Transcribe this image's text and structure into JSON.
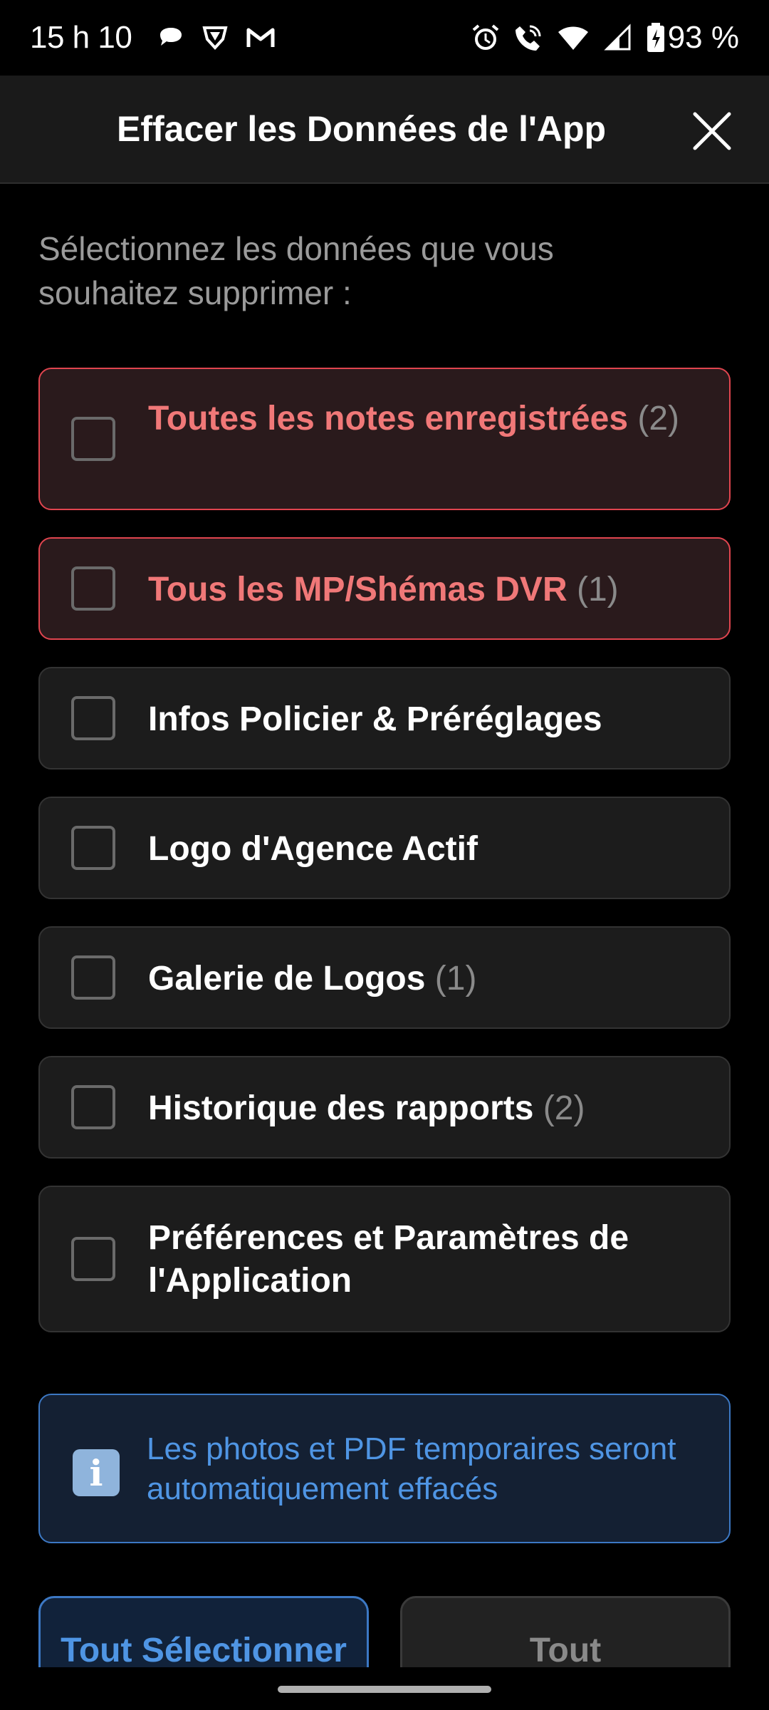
{
  "status_bar": {
    "time": "15 h 10",
    "battery": "93 %",
    "left_icons": [
      "chat-bubble-icon",
      "vpn-shield-icon",
      "gmail-icon"
    ],
    "right_icons": [
      "alarm-icon",
      "wifi-call-icon",
      "wifi-icon",
      "signal-icon",
      "battery-charging-icon"
    ]
  },
  "header": {
    "title": "Effacer les Données de l'App",
    "close_icon": "close-icon"
  },
  "prompt": "Sélectionnez les données que vous souhaitez supprimer :",
  "options": [
    {
      "label": "Toutes les notes enregistrées",
      "count": "(2)",
      "danger": true,
      "checked": false
    },
    {
      "label": "Tous les MP/Shémas DVR",
      "count": "(1)",
      "danger": true,
      "checked": false
    },
    {
      "label": "Infos Policier & Préréglages",
      "count": "",
      "danger": false,
      "checked": false
    },
    {
      "label": "Logo d'Agence Actif",
      "count": "",
      "danger": false,
      "checked": false
    },
    {
      "label": "Galerie de Logos",
      "count": "(1)",
      "danger": false,
      "checked": false
    },
    {
      "label": "Historique des rapports",
      "count": "(2)",
      "danger": false,
      "checked": false
    },
    {
      "label": "Préférences et Paramètres de l'Application",
      "count": "",
      "danger": false,
      "checked": false
    }
  ],
  "info": {
    "icon": "info-icon",
    "text": "Les photos et PDF temporaires seront automatiquement effacés"
  },
  "buttons": {
    "select_all": "Tout Sélectionner",
    "all": "Tout"
  },
  "colors": {
    "background": "#000000",
    "header": "#1a1a1a",
    "danger_border": "#e0454f",
    "danger_text": "#f07878",
    "accent_blue": "#4f95e4"
  }
}
